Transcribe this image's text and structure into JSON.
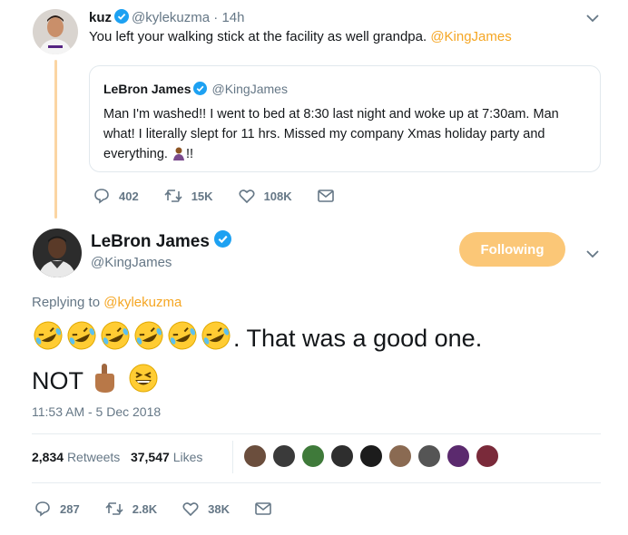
{
  "quoted_tweet": {
    "author_name": "kuz",
    "author_handle": "@kylekuzma",
    "time": "· 14h",
    "text": "You left your walking stick at the facility as well grandpa.",
    "mention": "@KingJames"
  },
  "quote_card": {
    "name": "LeBron James",
    "handle": "@KingJames",
    "text": "Man I'm washed!! I went to bed at 8:30 last night and woke up at 7:30am. Man what! I literally slept for 11 hrs. Missed my company Xmas holiday party and everything.",
    "text_suffix": "!!"
  },
  "quoted_actions": {
    "replies": "402",
    "retweets": "15K",
    "likes": "108K"
  },
  "main_tweet": {
    "name": "LeBron James",
    "handle": "@KingJames",
    "follow_label": "Following",
    "replying_prefix": "Replying to",
    "replying_mention": "@kylekuzma",
    "text_after_emojis": ". That was a good one.",
    "text_line2": "NOT",
    "timestamp": "11:53 AM - 5 Dec 2018",
    "retweets_count": "2,834",
    "retweets_label": "Retweets",
    "likes_count": "37,547",
    "likes_label": "Likes"
  },
  "main_actions": {
    "replies": "287",
    "retweets": "2.8K",
    "likes": "38K"
  },
  "icons": [
    "verified-icon",
    "chevron-down-icon",
    "reply-icon",
    "retweet-icon",
    "heart-icon",
    "mail-icon"
  ],
  "colors": {
    "accent": "#f5a623",
    "follow_button": "#fbc777",
    "verified": "#1da1f2",
    "muted": "#657786"
  }
}
